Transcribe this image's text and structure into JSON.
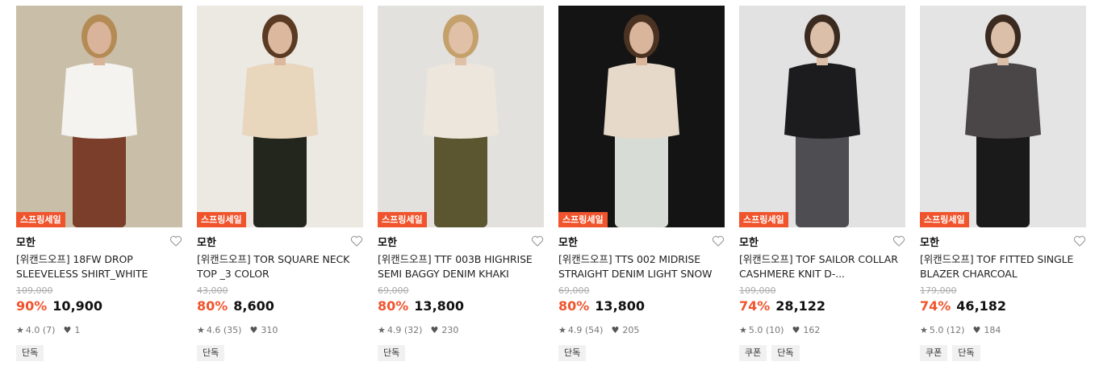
{
  "products": [
    {
      "badge": "스프링세일",
      "brand": "모한",
      "name": "[위캔드오프] 18FW DROP SLEEVELESS SHIRT_WHITE",
      "original_price": "109,000",
      "discount": "90%",
      "price": "10,900",
      "rating": "4.0 (7)",
      "likes": "1",
      "tags": [
        "단독"
      ],
      "image": {
        "bg": "#c9bfa8",
        "top": "#f4f3ef",
        "bottom": "#7a3e2a",
        "skin": "#d9b49a",
        "hair": "#b58b55"
      }
    },
    {
      "badge": "스프링세일",
      "brand": "모한",
      "name": "[위캔드오프] TOR SQUARE NECK TOP _3 COLOR",
      "original_price": "43,000",
      "discount": "80%",
      "price": "8,600",
      "rating": "4.6 (35)",
      "likes": "310",
      "tags": [
        "단독"
      ],
      "image": {
        "bg": "#ece8e2",
        "top": "#e8d6bd",
        "bottom": "#23261d",
        "skin": "#dcb89e",
        "hair": "#5a3a22"
      }
    },
    {
      "badge": "스프링세일",
      "brand": "모한",
      "name": "[위캔드오프] TTF 003B HIGHRISE SEMI BAGGY DENIM KHAKI",
      "original_price": "69,000",
      "discount": "80%",
      "price": "13,800",
      "rating": "4.9 (32)",
      "likes": "230",
      "tags": [
        "단독"
      ],
      "image": {
        "bg": "#e3e1dd",
        "top": "#ece6dc",
        "bottom": "#5b5630",
        "skin": "#e0c0a6",
        "hair": "#c4a06b"
      }
    },
    {
      "badge": "스프링세일",
      "brand": "모한",
      "name": "[위캔드오프] TTS 002 MIDRISE STRAIGHT DENIM LIGHT SNOW",
      "original_price": "69,000",
      "discount": "80%",
      "price": "13,800",
      "rating": "4.9 (54)",
      "likes": "205",
      "tags": [
        "단독"
      ],
      "image": {
        "bg": "#141414",
        "top": "#e6d9c9",
        "bottom": "#d8dcd6",
        "skin": "#d9b59b",
        "hair": "#4a3322"
      }
    },
    {
      "badge": "스프링세일",
      "brand": "모한",
      "name": "[위캔드오프] TOF SAILOR COLLAR CASHMERE KNIT D-...",
      "original_price": "109,000",
      "discount": "74%",
      "price": "28,122",
      "rating": "5.0 (10)",
      "likes": "162",
      "tags": [
        "쿠폰",
        "단독"
      ],
      "image": {
        "bg": "#e2e2e2",
        "top": "#1c1c1e",
        "bottom": "#4e4e52",
        "skin": "#dcbfa8",
        "hair": "#3a2a20"
      }
    },
    {
      "badge": "스프링세일",
      "brand": "모한",
      "name": "[위캔드오프] TOF FITTED SINGLE BLAZER CHARCOAL",
      "original_price": "179,000",
      "discount": "74%",
      "price": "46,182",
      "rating": "5.0 (12)",
      "likes": "184",
      "tags": [
        "쿠폰",
        "단독"
      ],
      "image": {
        "bg": "#e4e4e4",
        "top": "#4a4547",
        "bottom": "#1a1a1a",
        "skin": "#dcbfa8",
        "hair": "#3a2a20"
      }
    }
  ],
  "colors": {
    "accent": "#f0542d",
    "text": "#111111",
    "muted": "#aaaaaa"
  },
  "icons": {
    "wishlist": "heart-outline-icon",
    "rating": "star-icon",
    "likes": "heart-filled-icon"
  }
}
